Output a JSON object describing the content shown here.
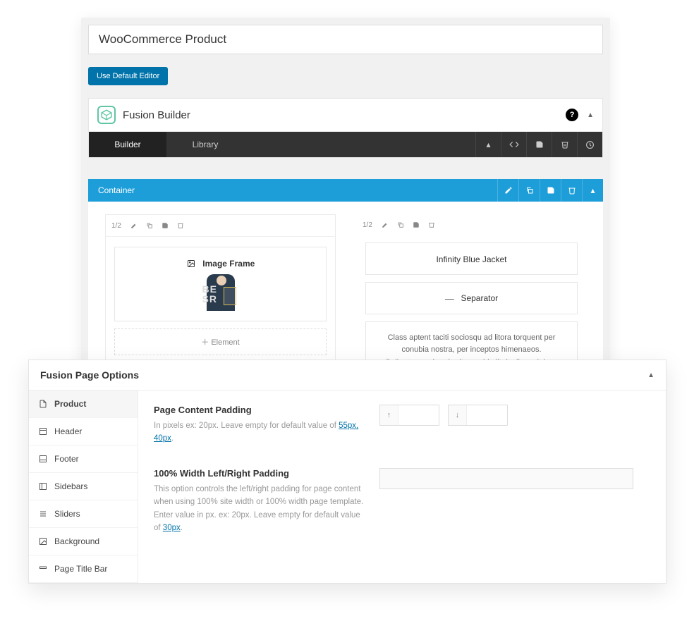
{
  "title": "WooCommerce Product",
  "defaultEditorBtn": "Use Default Editor",
  "fusionBuilder": {
    "title": "Fusion Builder",
    "tabs": {
      "builder": "Builder",
      "library": "Library"
    }
  },
  "container": {
    "label": "Container"
  },
  "col": {
    "ratio": "1/2",
    "imageFrame": "Image Frame",
    "addElement": "Element",
    "productTitle": "Infinity Blue Jacket",
    "separator": "Separator",
    "lorem": "Class aptent taciti sociosqu ad litora torquent per conubia nostra, per inceptos himenaeos. Pellentesque hendrerit urna id elit dapibus ultrices congue id est."
  },
  "options": {
    "title": "Fusion Page Options",
    "sidebar": [
      {
        "icon": "file",
        "label": "Product",
        "active": true
      },
      {
        "icon": "layout",
        "label": "Header"
      },
      {
        "icon": "layout",
        "label": "Footer"
      },
      {
        "icon": "columns",
        "label": "Sidebars"
      },
      {
        "icon": "sliders",
        "label": "Sliders"
      },
      {
        "icon": "image",
        "label": "Background"
      },
      {
        "icon": "bar",
        "label": "Page Title Bar"
      }
    ],
    "field1": {
      "label": "Page Content Padding",
      "help_pre": "In pixels ex: 20px. Leave empty for default value of ",
      "help_link": "55px, 40px"
    },
    "field2": {
      "label": "100% Width Left/Right Padding",
      "help_pre": "This option controls the left/right padding for page content when using 100% site width or 100% width page template. Enter value in px. ex: 20px. Leave empty for default value of ",
      "help_link": "30px"
    }
  }
}
